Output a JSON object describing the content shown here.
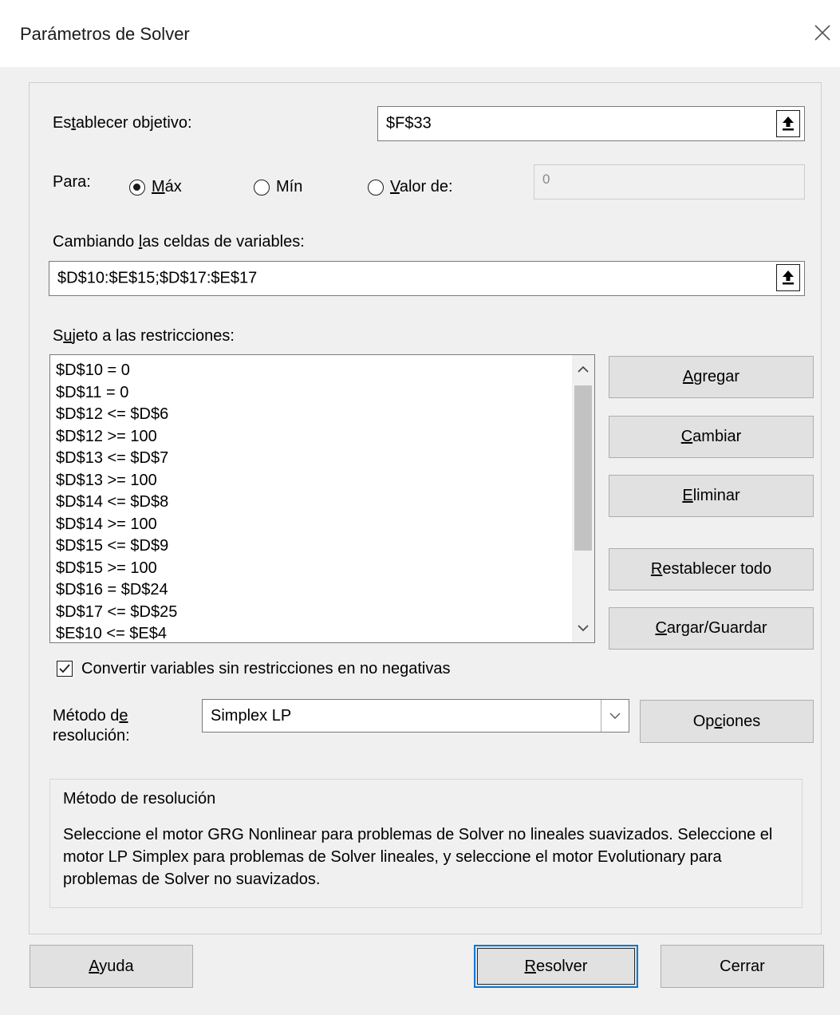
{
  "window": {
    "title": "Parámetros de Solver"
  },
  "objective": {
    "label_prefix": "Es",
    "label_accel": "t",
    "label_suffix": "ablecer objetivo:",
    "value": "$F$33"
  },
  "to": {
    "label": "Para:",
    "max_prefix": "",
    "max_accel": "M",
    "max_suffix": "áx",
    "min_label": "Mín",
    "valueof_accel": "V",
    "valueof_suffix": "alor de:",
    "valueof_value": "0",
    "selected": "max"
  },
  "variables": {
    "label_prefix": "Cambiando ",
    "label_accel": "l",
    "label_suffix": "as celdas de variables:",
    "value": "$D$10:$E$15;$D$17:$E$17"
  },
  "constraints": {
    "label_prefix": "S",
    "label_accel": "u",
    "label_suffix": "jeto a las restricciones:",
    "items": [
      "$D$10 = 0",
      "$D$11 = 0",
      "$D$12 <= $D$6",
      "$D$12 >= 100",
      "$D$13 <= $D$7",
      "$D$13 >= 100",
      "$D$14 <= $D$8",
      "$D$14 >= 100",
      "$D$15 <= $D$9",
      "$D$15 >= 100",
      "$D$16 = $D$24",
      "$D$17 <= $D$25",
      "$E$10 <= $E$4"
    ]
  },
  "buttons": {
    "add_accel": "A",
    "add_rest": "gregar",
    "change_accel": "C",
    "change_rest": "ambiar",
    "delete_accel": "E",
    "delete_rest": "liminar",
    "reset_accel": "R",
    "reset_rest": "establecer todo",
    "load_accel": "C",
    "load_rest": "argar/Guardar",
    "options_prefix": "Op",
    "options_accel": "c",
    "options_rest": "iones",
    "help_accel": "A",
    "help_rest": "yuda",
    "solve_accel": "R",
    "solve_rest": "esolver",
    "close": "Cerrar"
  },
  "nonneg": {
    "checked": true,
    "label": "Convertir variables sin restricciones en no negativas"
  },
  "method": {
    "label_line1_prefix": "Método d",
    "label_line1_accel": "e",
    "label_line2": "resolución:",
    "value": "Simplex LP"
  },
  "info": {
    "heading": "Método de resolución",
    "text": "Seleccione el motor GRG Nonlinear para problemas de Solver no lineales suavizados. Seleccione el motor LP Simplex para problemas de Solver lineales, y seleccione el motor Evolutionary para problemas de Solver no suavizados."
  },
  "icons": {
    "close": "close-icon",
    "collapse": "collapse-dialog-icon",
    "scroll_up": "chevron-up-icon",
    "scroll_down": "chevron-down-icon",
    "dropdown": "chevron-down-icon",
    "check": "checkmark-icon"
  },
  "colors": {
    "dialog_bg": "#f0f0f0",
    "button_bg": "#e1e1e1",
    "focus_border": "#0078d7"
  }
}
